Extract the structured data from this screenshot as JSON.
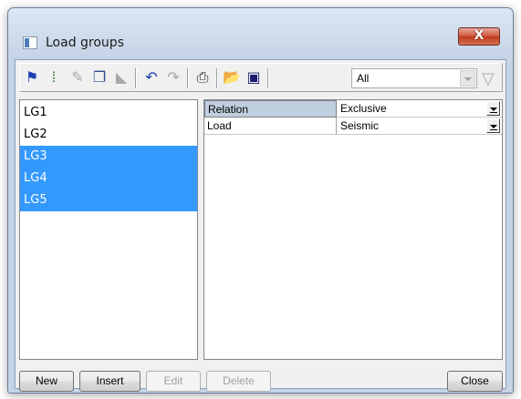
{
  "window": {
    "title": "Load groups",
    "close_glyph": "X"
  },
  "toolbar": {
    "buttons": [
      {
        "icon": "new-group-icon",
        "glyph": "⚑",
        "enabled": true,
        "color": "#1e3fb0"
      },
      {
        "icon": "insert-icon",
        "glyph": "⁞",
        "enabled": true,
        "color": "#1c6b2a"
      },
      {
        "icon": "edit-pencil-icon",
        "glyph": "✎",
        "enabled": false
      },
      {
        "icon": "copy-icon",
        "glyph": "❐",
        "enabled": true,
        "color": "#2d4f8e"
      },
      {
        "icon": "delete-icon",
        "glyph": "◣",
        "enabled": false
      },
      {
        "icon": "undo-icon",
        "glyph": "↶",
        "enabled": true,
        "color": "#1e3fb0"
      },
      {
        "icon": "redo-icon",
        "glyph": "↷",
        "enabled": false
      },
      {
        "icon": "print-icon",
        "glyph": "⎙",
        "enabled": true,
        "color": "#222222"
      },
      {
        "icon": "open-folder-icon",
        "glyph": "📂",
        "enabled": true,
        "color": "#c9a227"
      },
      {
        "icon": "save-icon",
        "glyph": "▣",
        "enabled": true,
        "color": "#1a1a6e"
      }
    ],
    "filter_value": "All"
  },
  "groups": [
    "LG1",
    "LG2",
    "LG3",
    "LG4",
    "LG5"
  ],
  "selected_groups": [
    "LG3",
    "LG4",
    "LG5"
  ],
  "properties": [
    {
      "name": "Relation",
      "value": "Exclusive"
    },
    {
      "name": "Load",
      "value": "Seismic"
    }
  ],
  "buttons": {
    "new": "New",
    "insert": "Insert",
    "edit": "Edit",
    "delete": "Delete",
    "close": "Close"
  },
  "colors": {
    "selection": "#3399ff",
    "title_close": "#c1391f"
  }
}
